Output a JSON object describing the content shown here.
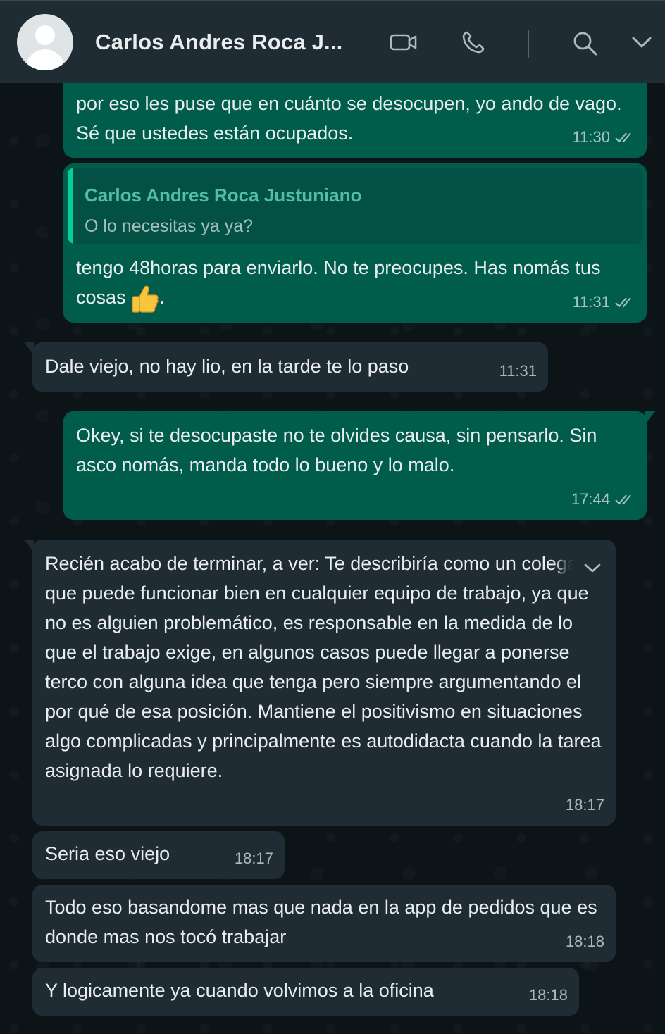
{
  "header": {
    "contact_name": "Carlos Andres Roca J...",
    "icons": [
      "video-call-icon",
      "phone-call-icon",
      "search-icon",
      "chevron-down-icon"
    ]
  },
  "colors": {
    "header_bg": "#202c33",
    "outgoing_bubble": "#005c4b",
    "incoming_bubble": "#202c33",
    "chat_bg": "#0d1418",
    "quote_name": "#53bdaa"
  },
  "messages": [
    {
      "direction": "out",
      "text": "por eso les puse que en cuánto se desocupen, yo ando de vago. Sé que ustedes están ocupados.",
      "time": "11:30",
      "status": "read"
    },
    {
      "direction": "out",
      "quoted_name": "Carlos Andres Roca Justuniano",
      "quoted_text": "O lo necesitas ya ya?",
      "text": "tengo 48horas para enviarlo. No te preocupes. Has nomás tus cosas",
      "emoji": "thumbs-up",
      "trailing": ".",
      "time": "11:31",
      "status": "read"
    },
    {
      "direction": "in",
      "text": "Dale viejo, no hay lio, en la tarde te lo paso",
      "time": "11:31"
    },
    {
      "direction": "out",
      "text": "Okey, si te desocupaste no te olvides causa, sin pensarlo. Sin asco nomás, manda todo lo bueno y lo malo.",
      "time": "17:44",
      "status": "read"
    },
    {
      "direction": "in",
      "text": "Recién acabo de terminar, a ver: Te describiría como un colega que puede funcionar bien en cualquier equipo de trabajo, ya que no es alguien problemático, es responsable en la medida de lo que el trabajo exige, en algunos casos puede llegar a ponerse terco con alguna idea que tenga pero siempre argumentando el por qué de esa posición. Mantiene el positivismo en situaciones algo complicadas y principalmente es autodidacta cuando la tarea asignada lo requiere.",
      "time": "18:17"
    },
    {
      "direction": "in",
      "text": "Seria eso viejo",
      "time": "18:17"
    },
    {
      "direction": "in",
      "text": "Todo eso basandome mas que nada en la app de pedidos que es donde mas nos tocó trabajar",
      "time": "18:18"
    },
    {
      "direction": "in",
      "text": "Y logicamente ya cuando volvimos a la oficina",
      "time": "18:18"
    }
  ]
}
